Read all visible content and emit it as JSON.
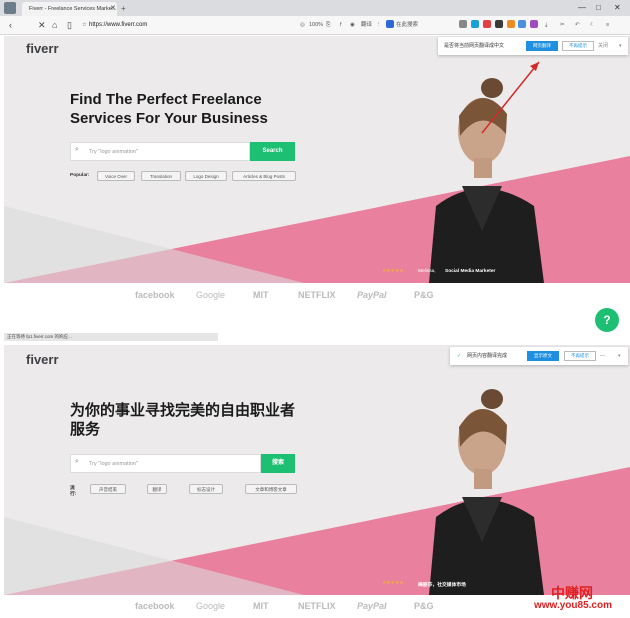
{
  "browser": {
    "tab_title": "Fiverr - Freelance Services Marke...",
    "tab_close": "✕",
    "new_tab": "+",
    "url": "https://www.fiverr.com",
    "zoom": "100%",
    "toolbar_text_1": "翻译",
    "toolbar_text_2": "在此搜索",
    "window_controls": [
      "—",
      "□",
      "✕"
    ]
  },
  "top": {
    "logo": "fiverr",
    "hero_line1": "Find The Perfect Freelance",
    "hero_line2": "Services For Your Business",
    "search_placeholder": "Try \"logo animation\"",
    "search_button": "Search",
    "popular_label": "Popular:",
    "tags": [
      "Voice Over",
      "Translation",
      "Logo Design",
      "Articles & Blog Posts"
    ],
    "stars": "★★★★★",
    "caption_name": "Melissa,",
    "caption_role": "Social Media Marketer",
    "translate_prompt": "是否将当前网页翻译成中文",
    "translate_button": "网页翻译",
    "never_button": "不再提示",
    "close_label": "关闭"
  },
  "brands": [
    "facebook",
    "Google",
    "MIT",
    "NETFLIX",
    "PayPal",
    "P&G"
  ],
  "status_bar": "正在等待 fp1.fiverr.com 的响应...",
  "chat_button": "?",
  "bottom": {
    "logo": "fiverr",
    "hero_line1": "为你的事业寻找完美的自由职业者",
    "hero_line2": "服务",
    "search_placeholder": "Try \"logo animation\"",
    "search_button": "搜索",
    "popular_label": "流行:",
    "tags": [
      "声音结束",
      "翻译",
      "标志设计",
      "文章和博客文章"
    ],
    "stars": "★★★★★",
    "caption": "梅丽莎，社交媒体市场",
    "translate_done": "网页内容翻译完成",
    "show_original": "显示原文",
    "never_button": "不再提示"
  },
  "watermark": {
    "cn": "中赚网",
    "url": "www.you85.com"
  },
  "colors": {
    "accent_green": "#1dbf73",
    "translate_blue": "#1e8fe1",
    "pink": "#e8809e",
    "arrow_red": "#d62828"
  }
}
